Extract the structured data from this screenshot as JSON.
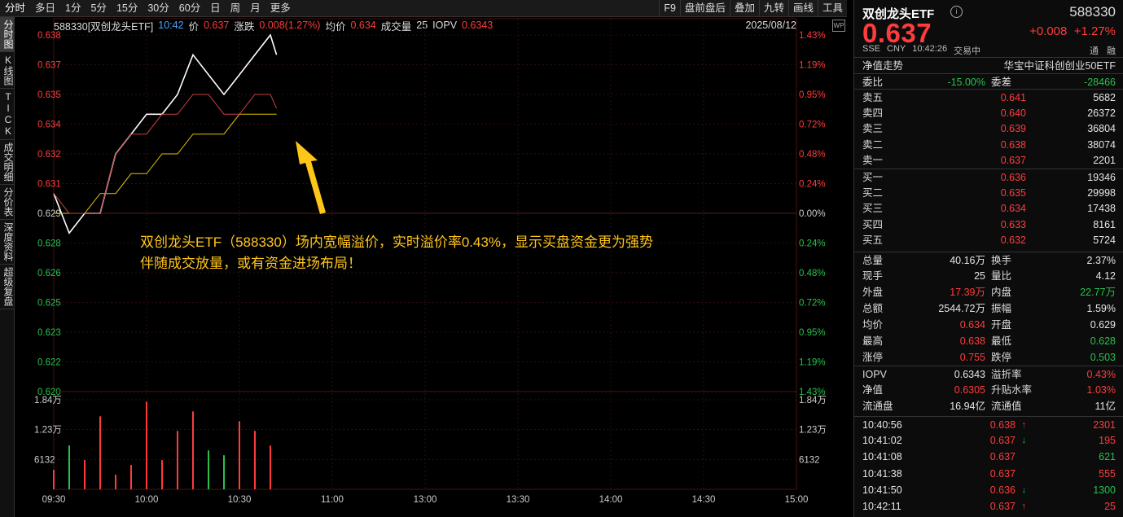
{
  "toolbar": {
    "left": [
      "分时",
      "多日",
      "1分",
      "5分",
      "15分",
      "30分",
      "60分",
      "日",
      "周",
      "月",
      "更多"
    ],
    "right": [
      "F9",
      "盘前盘后",
      "叠加",
      "九转",
      "画线",
      "工具"
    ]
  },
  "vtabs": [
    "分时图",
    "K线图",
    "TICK",
    "成交明细",
    "分价表",
    "深度资料",
    "超级复盘"
  ],
  "infobar": {
    "code_name": "588330[双创龙头ETF]",
    "time": "10:42",
    "price_label": "价",
    "price": "0.637",
    "change_label": "涨跌",
    "change": "0.008(1.27%)",
    "avg_label": "均价",
    "avg": "0.634",
    "vol_label": "成交量",
    "vol": "25",
    "iopv_label": "IOPV",
    "iopv": "0.6343",
    "date": "2025/08/12"
  },
  "price_axis": [
    "0.638",
    "0.637",
    "0.635",
    "0.634",
    "0.632",
    "0.631",
    "0.629",
    "0.628",
    "0.626",
    "0.625",
    "0.623",
    "0.622",
    "0.620"
  ],
  "pct_axis": [
    "1.43%",
    "1.19%",
    "0.95%",
    "0.72%",
    "0.48%",
    "0.24%",
    "0.00%",
    "0.24%",
    "0.48%",
    "0.72%",
    "0.95%",
    "1.19%",
    "1.43%"
  ],
  "vol_axis": [
    "1.84万",
    "1.23万",
    "6132"
  ],
  "time_axis": [
    "09:30",
    "10:00",
    "10:30",
    "11:00",
    "13:00",
    "13:30",
    "14:00",
    "14:30",
    "15:00"
  ],
  "annotation": [
    "双创龙头ETF（588330）场内宽幅溢价，实时溢价率0.43%，显示买盘资金更为强势",
    "伴随成交放量，或有资金进场布局！"
  ],
  "colors": {
    "up": "#ff3b3b",
    "down": "#27c24c",
    "price_line": "#ffffff",
    "avg_line": "#e6c200",
    "iopv_line": "#c94040",
    "arrow": "#ffc61a"
  },
  "chart_data": {
    "type": "line",
    "title": "588330[双创龙头ETF]",
    "x": [
      "09:30",
      "09:35",
      "09:40",
      "09:45",
      "09:50",
      "09:55",
      "10:00",
      "10:05",
      "10:10",
      "10:15",
      "10:20",
      "10:25",
      "10:30",
      "10:35",
      "10:40",
      "10:42"
    ],
    "series": [
      {
        "name": "价",
        "values": [
          0.63,
          0.628,
          0.629,
          0.629,
          0.632,
          0.633,
          0.634,
          0.634,
          0.635,
          0.637,
          0.636,
          0.635,
          0.636,
          0.637,
          0.638,
          0.637
        ]
      },
      {
        "name": "均价",
        "values": [
          0.629,
          0.629,
          0.629,
          0.63,
          0.63,
          0.631,
          0.631,
          0.632,
          0.632,
          0.633,
          0.633,
          0.633,
          0.634,
          0.634,
          0.634,
          0.634
        ]
      },
      {
        "name": "IOPV",
        "values": [
          0.63,
          0.629,
          0.629,
          0.629,
          0.632,
          0.633,
          0.633,
          0.634,
          0.634,
          0.635,
          0.635,
          0.634,
          0.634,
          0.635,
          0.635,
          0.6343
        ]
      }
    ],
    "ylim": [
      0.62,
      0.638
    ],
    "volume": {
      "name": "成交量",
      "values": [
        4000,
        9000,
        6000,
        15000,
        3000,
        5000,
        18000,
        6000,
        12000,
        16000,
        8000,
        7000,
        14000,
        12000,
        9000,
        25
      ]
    },
    "vol_ylim": [
      0,
      18400
    ]
  },
  "panel": {
    "name": "双创龙头ETF",
    "code": "588330",
    "price": "0.637",
    "change": "+0.008",
    "change_pct": "+1.27%",
    "exchange": "SSE",
    "currency": "CNY",
    "time": "10:42:26",
    "status": "交易中",
    "tabs": [
      "通",
      "融"
    ],
    "nav_label": "净值走势",
    "index_name": "华宝中证科创创业50ETF",
    "weibi_label": "委比",
    "weibi": "-15.00%",
    "weicha_label": "委差",
    "weicha": "-28466",
    "asks": [
      {
        "label": "卖五",
        "price": "0.641",
        "vol": "5682"
      },
      {
        "label": "卖四",
        "price": "0.640",
        "vol": "26372"
      },
      {
        "label": "卖三",
        "price": "0.639",
        "vol": "36804"
      },
      {
        "label": "卖二",
        "price": "0.638",
        "vol": "38074"
      },
      {
        "label": "卖一",
        "price": "0.637",
        "vol": "2201"
      }
    ],
    "bids": [
      {
        "label": "买一",
        "price": "0.636",
        "vol": "19346"
      },
      {
        "label": "买二",
        "price": "0.635",
        "vol": "29998"
      },
      {
        "label": "买三",
        "price": "0.634",
        "vol": "17438"
      },
      {
        "label": "买四",
        "price": "0.633",
        "vol": "8161"
      },
      {
        "label": "买五",
        "price": "0.632",
        "vol": "5724"
      }
    ],
    "stats": [
      {
        "l1": "总量",
        "v1": "40.16万",
        "c1": "white",
        "l2": "换手",
        "v2": "2.37%",
        "c2": "white"
      },
      {
        "l1": "现手",
        "v1": "25",
        "c1": "white",
        "l2": "量比",
        "v2": "4.12",
        "c2": "white"
      },
      {
        "l1": "外盘",
        "v1": "17.39万",
        "c1": "red",
        "l2": "内盘",
        "v2": "22.77万",
        "c2": "green"
      },
      {
        "l1": "总额",
        "v1": "2544.72万",
        "c1": "white",
        "l2": "振幅",
        "v2": "1.59%",
        "c2": "white"
      },
      {
        "l1": "均价",
        "v1": "0.634",
        "c1": "red",
        "l2": "开盘",
        "v2": "0.629",
        "c2": "white"
      },
      {
        "l1": "最高",
        "v1": "0.638",
        "c1": "red",
        "l2": "最低",
        "v2": "0.628",
        "c2": "green"
      },
      {
        "l1": "涨停",
        "v1": "0.755",
        "c1": "red",
        "l2": "跌停",
        "v2": "0.503",
        "c2": "green"
      }
    ],
    "stats2": [
      {
        "l1": "IOPV",
        "v1": "0.6343",
        "c1": "white",
        "l2": "溢折率",
        "v2": "0.43%",
        "c2": "red"
      },
      {
        "l1": "净值",
        "v1": "0.6305",
        "c1": "red",
        "l2": "升贴水率",
        "v2": "1.03%",
        "c2": "red"
      },
      {
        "l1": "流通盘",
        "v1": "16.94亿",
        "c1": "white",
        "l2": "流通值",
        "v2": "11亿",
        "c2": "white"
      }
    ],
    "ticks": [
      {
        "time": "10:40:56",
        "price": "0.638",
        "pc": "red",
        "dir": "up",
        "vol": "2301",
        "vc": "red"
      },
      {
        "time": "10:41:02",
        "price": "0.637",
        "pc": "red",
        "dir": "down",
        "vol": "195",
        "vc": "red"
      },
      {
        "time": "10:41:08",
        "price": "0.637",
        "pc": "red",
        "dir": "",
        "vol": "621",
        "vc": "green"
      },
      {
        "time": "10:41:38",
        "price": "0.637",
        "pc": "red",
        "dir": "",
        "vol": "555",
        "vc": "red"
      },
      {
        "time": "10:41:50",
        "price": "0.636",
        "pc": "red",
        "dir": "down",
        "vol": "1300",
        "vc": "green"
      },
      {
        "time": "10:42:11",
        "price": "0.637",
        "pc": "red",
        "dir": "up",
        "vol": "25",
        "vc": "red"
      }
    ]
  }
}
